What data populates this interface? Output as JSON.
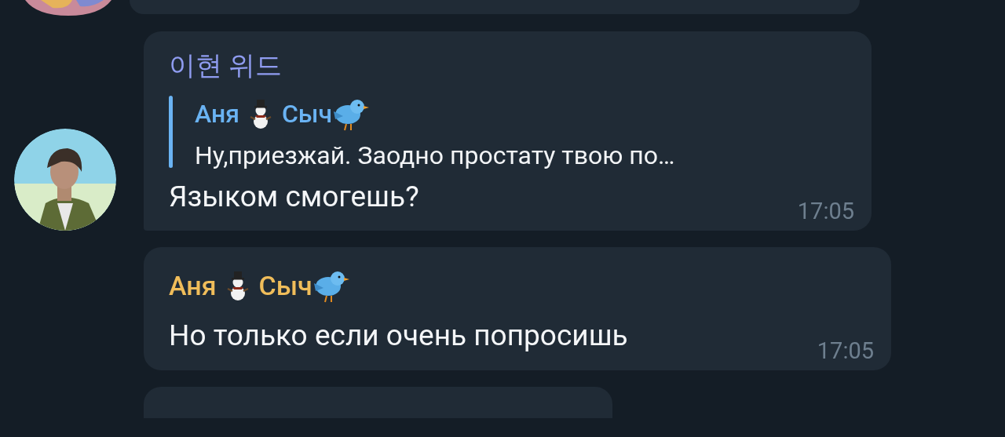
{
  "messages": [
    {
      "sender": {
        "parts": [
          "이현 위드"
        ],
        "color": "#8f9cf0"
      },
      "reply": {
        "sender": {
          "parts": [
            "Аня",
            "Сыч"
          ],
          "color": "#6ab3f3"
        },
        "text": "Ну,приезжай. Заодно простату твою по…"
      },
      "text": "Языком смогешь?",
      "time": "17:05",
      "avatar": true
    },
    {
      "sender": {
        "parts": [
          "Аня",
          "Сыч"
        ],
        "color": "#f0bd5a"
      },
      "text": "Но только если очень попросишь",
      "time": "17:05",
      "avatar": false
    }
  ]
}
